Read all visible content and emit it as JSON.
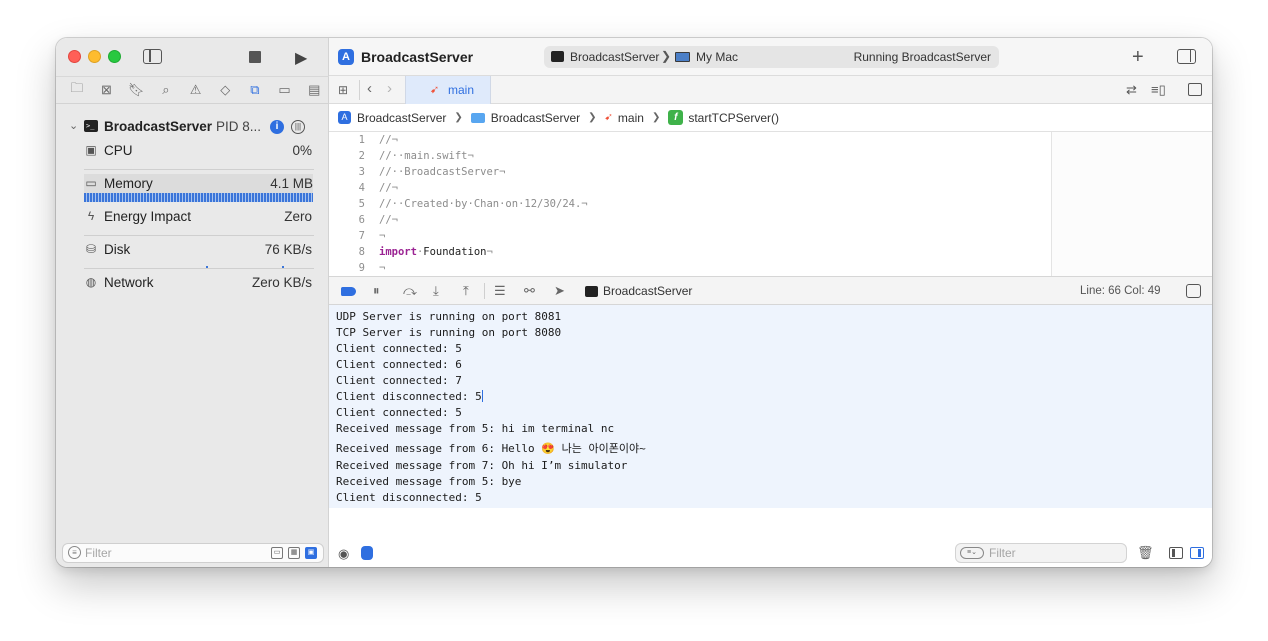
{
  "window": {
    "project_title": "BroadcastServer"
  },
  "scheme": {
    "name": "BroadcastServer",
    "separator": "❯",
    "destination": "My Mac",
    "status": "Running BroadcastServer"
  },
  "tab": {
    "label": "main"
  },
  "breadcrumb": [
    "BroadcastServer",
    "BroadcastServer",
    "main",
    "startTCPServer()"
  ],
  "breadcrumb_sep": "❯",
  "process": {
    "name": "BroadcastServer",
    "pid": "PID 8..."
  },
  "gauges": [
    {
      "label": "CPU",
      "value": "0%",
      "icon": "cpu-icon"
    },
    {
      "label": "Memory",
      "value": "4.1 MB",
      "icon": "memory-icon"
    },
    {
      "label": "Energy Impact",
      "value": "Zero",
      "icon": "energy-icon"
    },
    {
      "label": "Disk",
      "value": "76 KB/s",
      "icon": "disk-icon"
    },
    {
      "label": "Network",
      "value": "Zero KB/s",
      "icon": "network-icon"
    }
  ],
  "sidebar_filter": {
    "placeholder": "Filter"
  },
  "code": [
    {
      "n": "1",
      "text": "//¬"
    },
    {
      "n": "2",
      "text": "//··main.swift¬"
    },
    {
      "n": "3",
      "text": "//··BroadcastServer¬"
    },
    {
      "n": "4",
      "text": "//¬"
    },
    {
      "n": "5",
      "text": "//··Created·by·Chan·on·12/30/24.¬"
    },
    {
      "n": "6",
      "text": "//¬"
    },
    {
      "n": "7",
      "text": "¬"
    },
    {
      "n": "8",
      "keyword": "import",
      "rest": "Foundation",
      "sep": "·",
      "end": "¬"
    },
    {
      "n": "9",
      "text": "¬"
    }
  ],
  "debug": {
    "process": "BroadcastServer",
    "position": "Line: 66  Col: 49"
  },
  "console": [
    "UDP Server is running on port 8081",
    "TCP Server is running on port 8080",
    "Client connected: 5",
    "Client connected: 6",
    "Client connected: 7",
    "Client disconnected: 5",
    "Client connected: 5",
    "Received message from 5: hi im terminal nc",
    "Received message from 6: Hello 😍 나는 아이폰이야~",
    "Received message from 7: Oh hi I’m simulator",
    "Received message from 5: bye",
    "Client disconnected: 5"
  ],
  "console_filter": {
    "placeholder": "Filter"
  },
  "colors": {
    "accent": "#2f6fe0",
    "swift": "#f05138",
    "keyword": "#9b2393"
  }
}
